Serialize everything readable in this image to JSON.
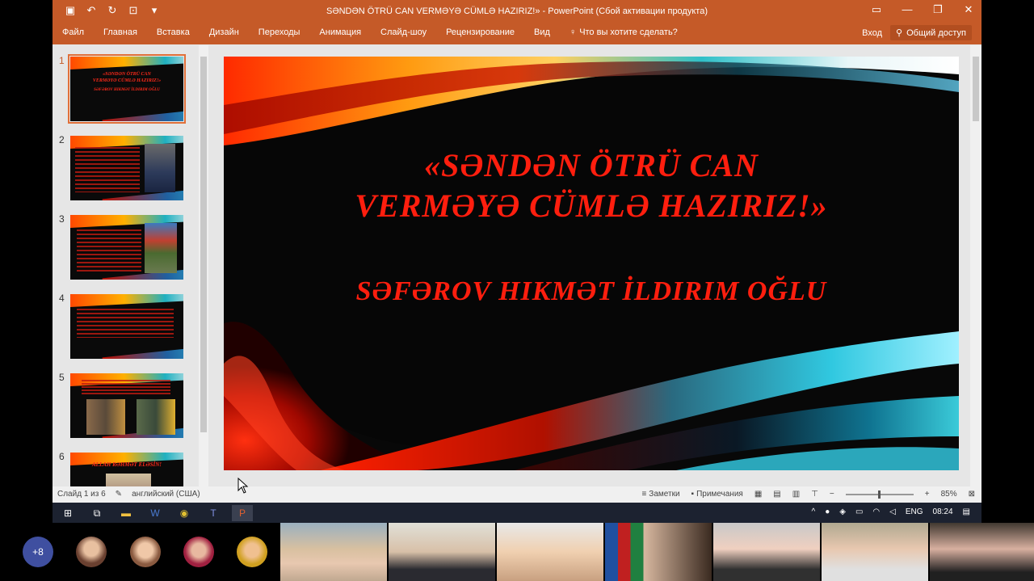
{
  "window": {
    "title": "SƏNDƏN ÖTRÜ CAN VERMƏYƏ CÜMLƏ HAZIRIZ!» - PowerPoint (Сбой активации продукта)"
  },
  "ribbon": {
    "tabs": [
      "Файл",
      "Главная",
      "Вставка",
      "Дизайн",
      "Переходы",
      "Анимация",
      "Слайд-шоу",
      "Рецензирование",
      "Вид"
    ],
    "tell_me": "Что вы хотите сделать?",
    "signin": "Вход",
    "share": "Общий доступ"
  },
  "thumbnails": [
    {
      "num": "1",
      "lines": [
        "«SƏNDƏN ÖTRÜ CAN",
        "VERMƏYƏ CÜMLƏ HAZIRIZ!»",
        "SƏFƏROV HIKMƏT İLDIRIM OĞLU"
      ]
    },
    {
      "num": "2"
    },
    {
      "num": "3"
    },
    {
      "num": "4"
    },
    {
      "num": "5"
    },
    {
      "num": "6",
      "lines": [
        "ALLAH RƏHMƏT ELƏSİN!"
      ]
    }
  ],
  "slide": {
    "title_line1": "«SƏNDƏN ÖTRÜ CAN",
    "title_line2": "VERMƏYƏ CÜMLƏ HAZIRIZ!»",
    "subtitle": "SƏFƏROV HIKMƏT İLDIRIM  OĞLU"
  },
  "status": {
    "slide_info": "Слайд 1 из 6",
    "language": "английский (США)",
    "notes": "Заметки",
    "comments": "Примечания",
    "zoom": "85%"
  },
  "taskbar": {
    "lang": "ENG",
    "time": "08:24"
  },
  "call": {
    "more_count": "+8"
  },
  "colors": {
    "accent": "#c55a28",
    "slide_text": "#ff1e0e"
  }
}
